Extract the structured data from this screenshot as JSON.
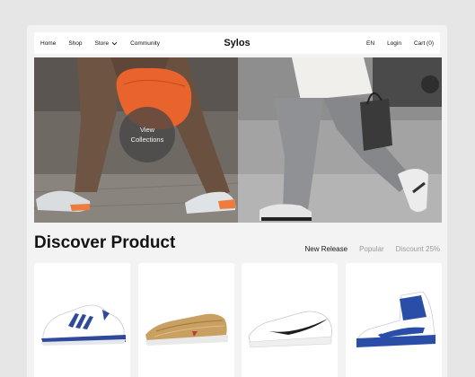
{
  "nav": {
    "links": [
      "Home",
      "Shop",
      "Store",
      "Community"
    ],
    "brand": "Sylos",
    "lang": "EN",
    "login": "Login",
    "cart": "Cart (0)"
  },
  "hero": {
    "cta_line1": "View",
    "cta_line2": "Collections"
  },
  "discover": {
    "title": "Discover Product",
    "tabs": [
      "New Release",
      "Popular",
      "Discount 25%"
    ],
    "active_tab": "New Release"
  },
  "products": [
    {
      "icon": "white-blue-sneaker-icon"
    },
    {
      "icon": "gold-sneaker-icon"
    },
    {
      "icon": "white-black-sneaker-icon"
    },
    {
      "icon": "blue-high-top-sneaker-icon"
    }
  ],
  "colors": {
    "page_bg": "#e6e6e6",
    "frame_bg": "#f3f3f3",
    "text": "#141414",
    "muted": "#9a9a9a",
    "bag_orange": "#e8642c"
  }
}
